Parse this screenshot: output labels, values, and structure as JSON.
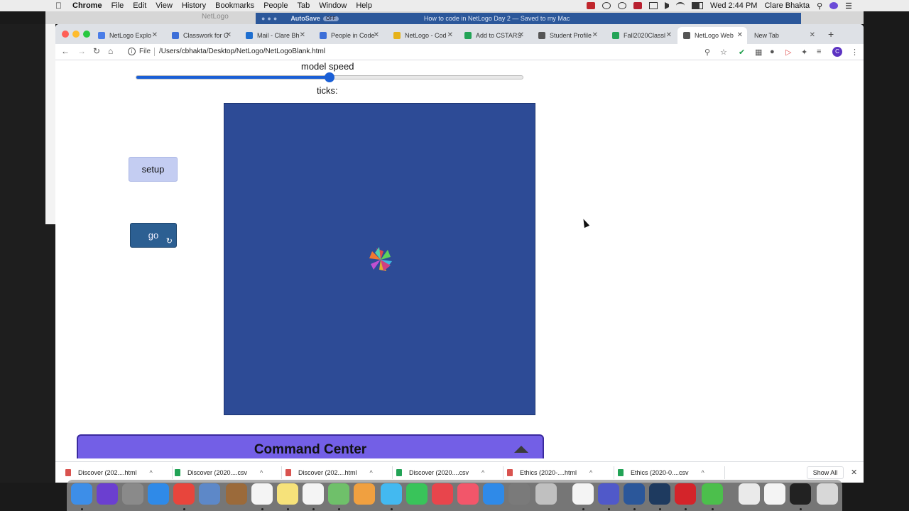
{
  "menubar": {
    "app_name": "Chrome",
    "items": [
      "File",
      "Edit",
      "View",
      "History",
      "Bookmarks",
      "People",
      "Tab",
      "Window",
      "Help"
    ],
    "clock": "Wed 2:44 PM",
    "user": "Clare Bhakta"
  },
  "background_windows": {
    "netlogo_title": "NetLogo",
    "word_autosave": "AutoSave",
    "word_autosave_state": "OFF",
    "word_doc_title": "How to code in NetLogo Day 2 — Saved to my Mac"
  },
  "browser": {
    "tabs": [
      {
        "label": "NetLogo Explo",
        "icon": "google-doc-icon",
        "color": "#4a7de8"
      },
      {
        "label": "Classwork for C",
        "icon": "classroom-icon",
        "color": "#3d6fd8"
      },
      {
        "label": "Mail - Clare Bh",
        "icon": "outlook-icon",
        "color": "#1f6fd0"
      },
      {
        "label": "People in Code",
        "icon": "classroom-icon",
        "color": "#3d6fd8"
      },
      {
        "label": "NetLogo - Cod",
        "icon": "drive-icon",
        "color": "#e6b21a"
      },
      {
        "label": "Add to CSTARS",
        "icon": "sheets-icon",
        "color": "#22a356"
      },
      {
        "label": "Student Profile",
        "icon": "globe-icon",
        "color": "#555555"
      },
      {
        "label": "Fall2020Classl",
        "icon": "sheets-icon",
        "color": "#22a356"
      },
      {
        "label": "NetLogo Web",
        "icon": "globe-icon",
        "color": "#555555",
        "active": true
      },
      {
        "label": "New Tab",
        "icon": "",
        "color": ""
      }
    ],
    "url_scheme": "File",
    "url": "/Users/cbhakta/Desktop/NetLogo/NetLogoBlank.html",
    "profile_initial": "C"
  },
  "netlogo": {
    "speed_label": "model speed",
    "speed_value": 0.5,
    "ticks_label": "ticks:",
    "setup_label": "setup",
    "go_label": "go",
    "go_forever_icon": "↻",
    "world_color": "#2d4b96",
    "command_center_title": "Command Center"
  },
  "downloads": {
    "items": [
      {
        "name": "Discover (202....html",
        "type": "html"
      },
      {
        "name": "Discover (2020....csv",
        "type": "csv"
      },
      {
        "name": "Discover (202....html",
        "type": "html"
      },
      {
        "name": "Discover (2020....csv",
        "type": "csv"
      },
      {
        "name": "Ethics (2020-....html",
        "type": "html"
      },
      {
        "name": "Ethics (2020-0....csv",
        "type": "csv"
      }
    ],
    "show_all": "Show All",
    "close": "✕"
  }
}
